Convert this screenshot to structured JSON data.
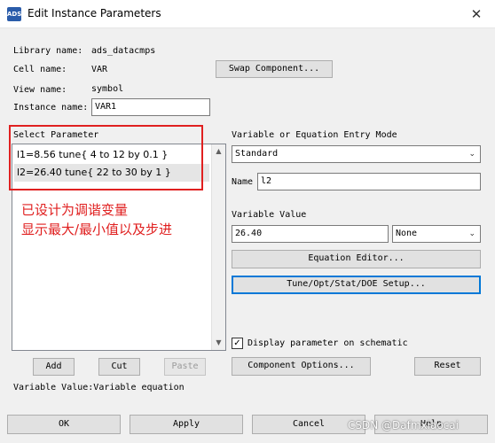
{
  "window": {
    "title": "Edit Instance Parameters",
    "icon_text": "ADS",
    "close_glyph": "✕"
  },
  "info": {
    "library_label": "Library name:",
    "library_value": "ads_datacmps",
    "cell_label": "Cell name:",
    "cell_value": "VAR",
    "view_label": "View name:",
    "view_value": "symbol",
    "instance_label": "Instance name:",
    "instance_value": "VAR1",
    "swap_button": "Swap Component..."
  },
  "select_parameter": {
    "header": "Select Parameter",
    "items": [
      "l1=8.56 tune{ 4 to 12 by 0.1 }",
      "l2=26.40 tune{ 22 to 30 by 1 }"
    ],
    "selected_index": 1,
    "annotation_line1": "已设计为调谐变量",
    "annotation_line2": "显示最大/最小值以及步进",
    "highlight_color": "#e02020"
  },
  "list_buttons": {
    "add": "Add",
    "cut": "Cut",
    "paste": "Paste"
  },
  "right_panel": {
    "mode_label": "Variable or Equation Entry Mode",
    "mode_value": "Standard",
    "name_label": "Name",
    "name_value": "l2",
    "value_label": "Variable Value",
    "value_value": "26.40",
    "unit_value": "None",
    "equation_editor": "Equation Editor...",
    "tune_setup": "Tune/Opt/Stat/DOE Setup...",
    "display_checkbox_label": "Display parameter on schematic",
    "display_checked": true,
    "check_glyph": "✓",
    "component_options": "Component Options...",
    "reset": "Reset"
  },
  "status_text": "Variable Value:Variable equation",
  "footer": {
    "ok": "OK",
    "apply": "Apply",
    "cancel": "Cancel",
    "help": "Help"
  },
  "watermark": "CSDN @Dafmxiaocai",
  "glyphs": {
    "dropdown_arrow": "⌄",
    "scroll_up": "▲",
    "scroll_down": "▼"
  },
  "colors": {
    "accent": "#0078d7",
    "annotation": "#e02020",
    "selected_row": "#e5e5e5"
  }
}
